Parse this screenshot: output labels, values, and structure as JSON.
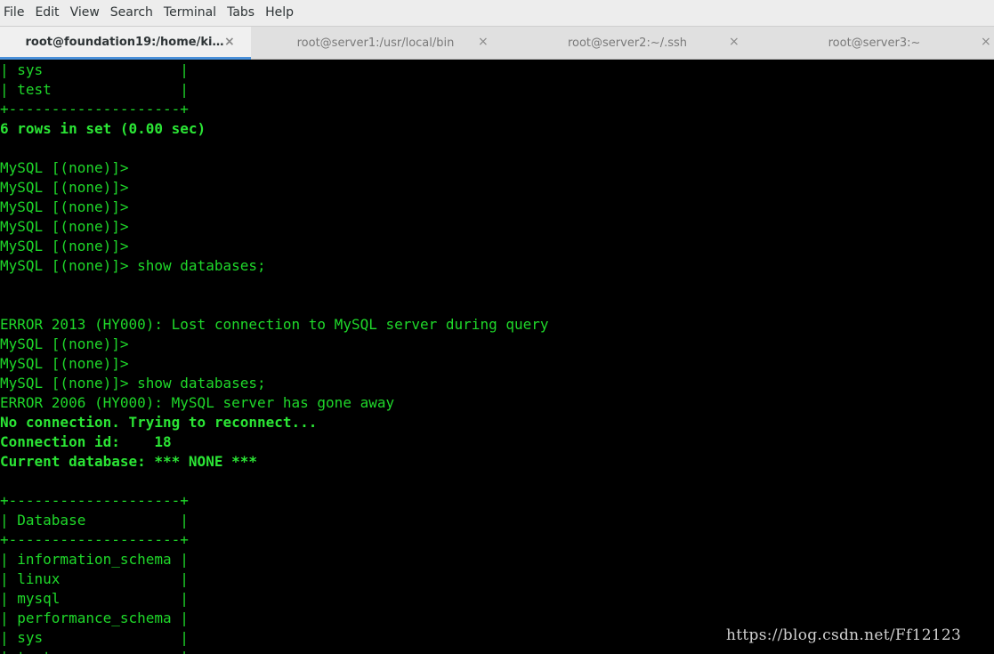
{
  "menubar": {
    "items": [
      "File",
      "Edit",
      "View",
      "Search",
      "Terminal",
      "Tabs",
      "Help"
    ]
  },
  "tabs": [
    {
      "label": "root@foundation19:/home/kio...",
      "active": true
    },
    {
      "label": "root@server1:/usr/local/bin",
      "active": false
    },
    {
      "label": "root@server2:~/.ssh",
      "active": false
    },
    {
      "label": "root@server3:~",
      "active": false
    }
  ],
  "tab_close_glyph": "×",
  "colors": {
    "terminal_text": "#1fd82a",
    "terminal_bg": "#000000",
    "active_tab_underline": "#4a90d9"
  },
  "terminal": {
    "lines": [
      {
        "text": "| sys                |",
        "bold": false
      },
      {
        "text": "| test               |",
        "bold": false
      },
      {
        "text": "+--------------------+",
        "bold": false
      },
      {
        "text": "6 rows in set (0.00 sec)",
        "bold": true
      },
      {
        "text": "",
        "bold": false
      },
      {
        "text": "MySQL [(none)]>",
        "bold": false
      },
      {
        "text": "MySQL [(none)]>",
        "bold": false
      },
      {
        "text": "MySQL [(none)]>",
        "bold": false
      },
      {
        "text": "MySQL [(none)]>",
        "bold": false
      },
      {
        "text": "MySQL [(none)]>",
        "bold": false
      },
      {
        "text": "MySQL [(none)]> show databases;",
        "bold": false
      },
      {
        "text": "",
        "bold": false
      },
      {
        "text": "",
        "bold": false
      },
      {
        "text": "ERROR 2013 (HY000): Lost connection to MySQL server during query",
        "bold": false
      },
      {
        "text": "MySQL [(none)]>",
        "bold": false
      },
      {
        "text": "MySQL [(none)]>",
        "bold": false
      },
      {
        "text": "MySQL [(none)]> show databases;",
        "bold": false
      },
      {
        "text": "ERROR 2006 (HY000): MySQL server has gone away",
        "bold": false
      },
      {
        "text": "No connection. Trying to reconnect...",
        "bold": true
      },
      {
        "text": "Connection id:    18",
        "bold": true
      },
      {
        "text": "Current database: *** NONE ***",
        "bold": true
      },
      {
        "text": "",
        "bold": false
      },
      {
        "text": "+--------------------+",
        "bold": false
      },
      {
        "text": "| Database           |",
        "bold": false
      },
      {
        "text": "+--------------------+",
        "bold": false
      },
      {
        "text": "| information_schema |",
        "bold": false
      },
      {
        "text": "| linux              |",
        "bold": false
      },
      {
        "text": "| mysql              |",
        "bold": false
      },
      {
        "text": "| performance_schema |",
        "bold": false
      },
      {
        "text": "| sys                |",
        "bold": false
      },
      {
        "text": "| test               |",
        "bold": false
      }
    ]
  },
  "watermark": "https://blog.csdn.net/Ff12123"
}
